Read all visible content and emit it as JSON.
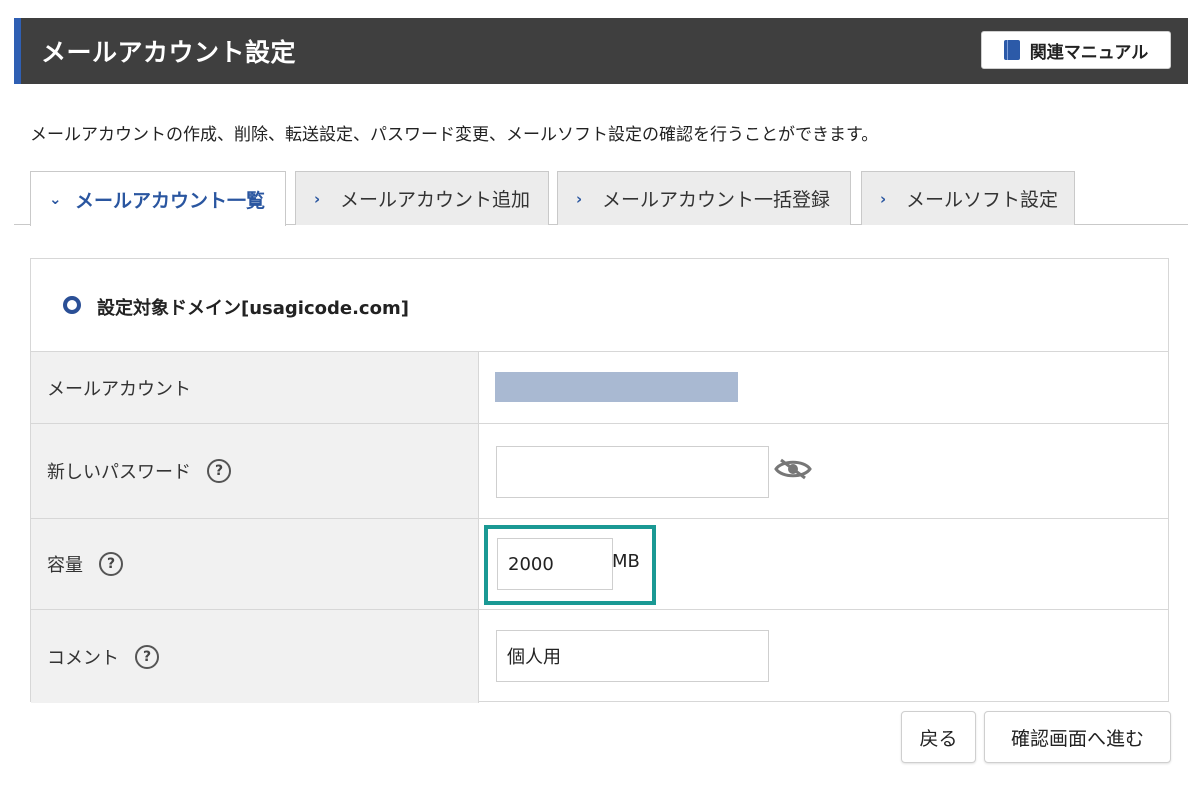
{
  "header": {
    "title": "メールアカウント設定",
    "manual_label": "関連マニュアル"
  },
  "description": "メールアカウントの作成、削除、転送設定、パスワード変更、メールソフト設定の確認を行うことができます。",
  "tabs": [
    {
      "label": "メールアカウント一覧",
      "active": true
    },
    {
      "label": "メールアカウント追加",
      "active": false
    },
    {
      "label": "メールアカウント一括登録",
      "active": false
    },
    {
      "label": "メールソフト設定",
      "active": false
    }
  ],
  "domain": {
    "label": "設定対象ドメイン[usagicode.com]"
  },
  "form": {
    "account_label": "メールアカウント",
    "password_label": "新しいパスワード",
    "password_value": "",
    "capacity_label": "容量",
    "capacity_value": "2000",
    "capacity_unit": "MB",
    "comment_label": "コメント",
    "comment_value": "個人用",
    "help_symbol": "?"
  },
  "buttons": {
    "back": "戻る",
    "confirm": "確認画面へ進む"
  },
  "colors": {
    "header_bg": "#3f3f3f",
    "accent": "#2a56a0",
    "highlight": "#1a9994",
    "masked": "#a9b9d2"
  }
}
